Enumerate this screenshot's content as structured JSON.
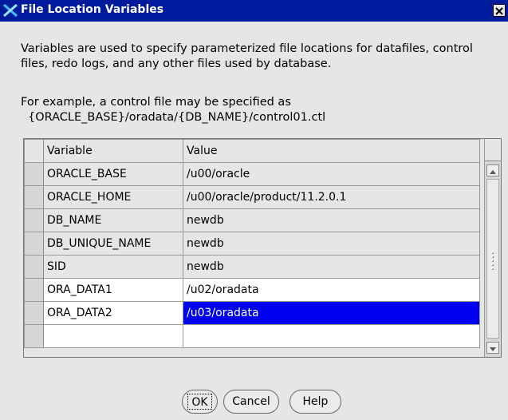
{
  "window": {
    "title": "File Location Variables",
    "icon": "x-logo-icon",
    "close_label": "×"
  },
  "description": "Variables are used to specify parameterized file locations for datafiles, control files, redo logs, and any other files used by database.",
  "example": {
    "line1": "For example, a control file may be specified as",
    "line2": "{ORACLE_BASE}/oradata/{DB_NAME}/control01.ctl"
  },
  "table": {
    "columns": [
      "Variable",
      "Value"
    ],
    "rows": [
      {
        "variable": "ORACLE_BASE",
        "value": "/u00/oracle",
        "editable": false
      },
      {
        "variable": "ORACLE_HOME",
        "value": "/u00/oracle/product/11.2.0.1",
        "editable": false
      },
      {
        "variable": "DB_NAME",
        "value": "newdb",
        "editable": false
      },
      {
        "variable": "DB_UNIQUE_NAME",
        "value": "newdb",
        "editable": false
      },
      {
        "variable": "SID",
        "value": "newdb",
        "editable": false
      },
      {
        "variable": "ORA_DATA1",
        "value": "/u02/oradata",
        "editable": true
      },
      {
        "variable": "ORA_DATA2",
        "value": "/u03/oradata",
        "editable": true,
        "selected": true
      },
      {
        "variable": "",
        "value": "",
        "editable": true
      }
    ]
  },
  "buttons": {
    "ok": "OK",
    "cancel": "Cancel",
    "help": "Help"
  },
  "colors": {
    "titlebar": "#001a9e",
    "selection": "#0000f0",
    "background": "#e6e6e6"
  }
}
